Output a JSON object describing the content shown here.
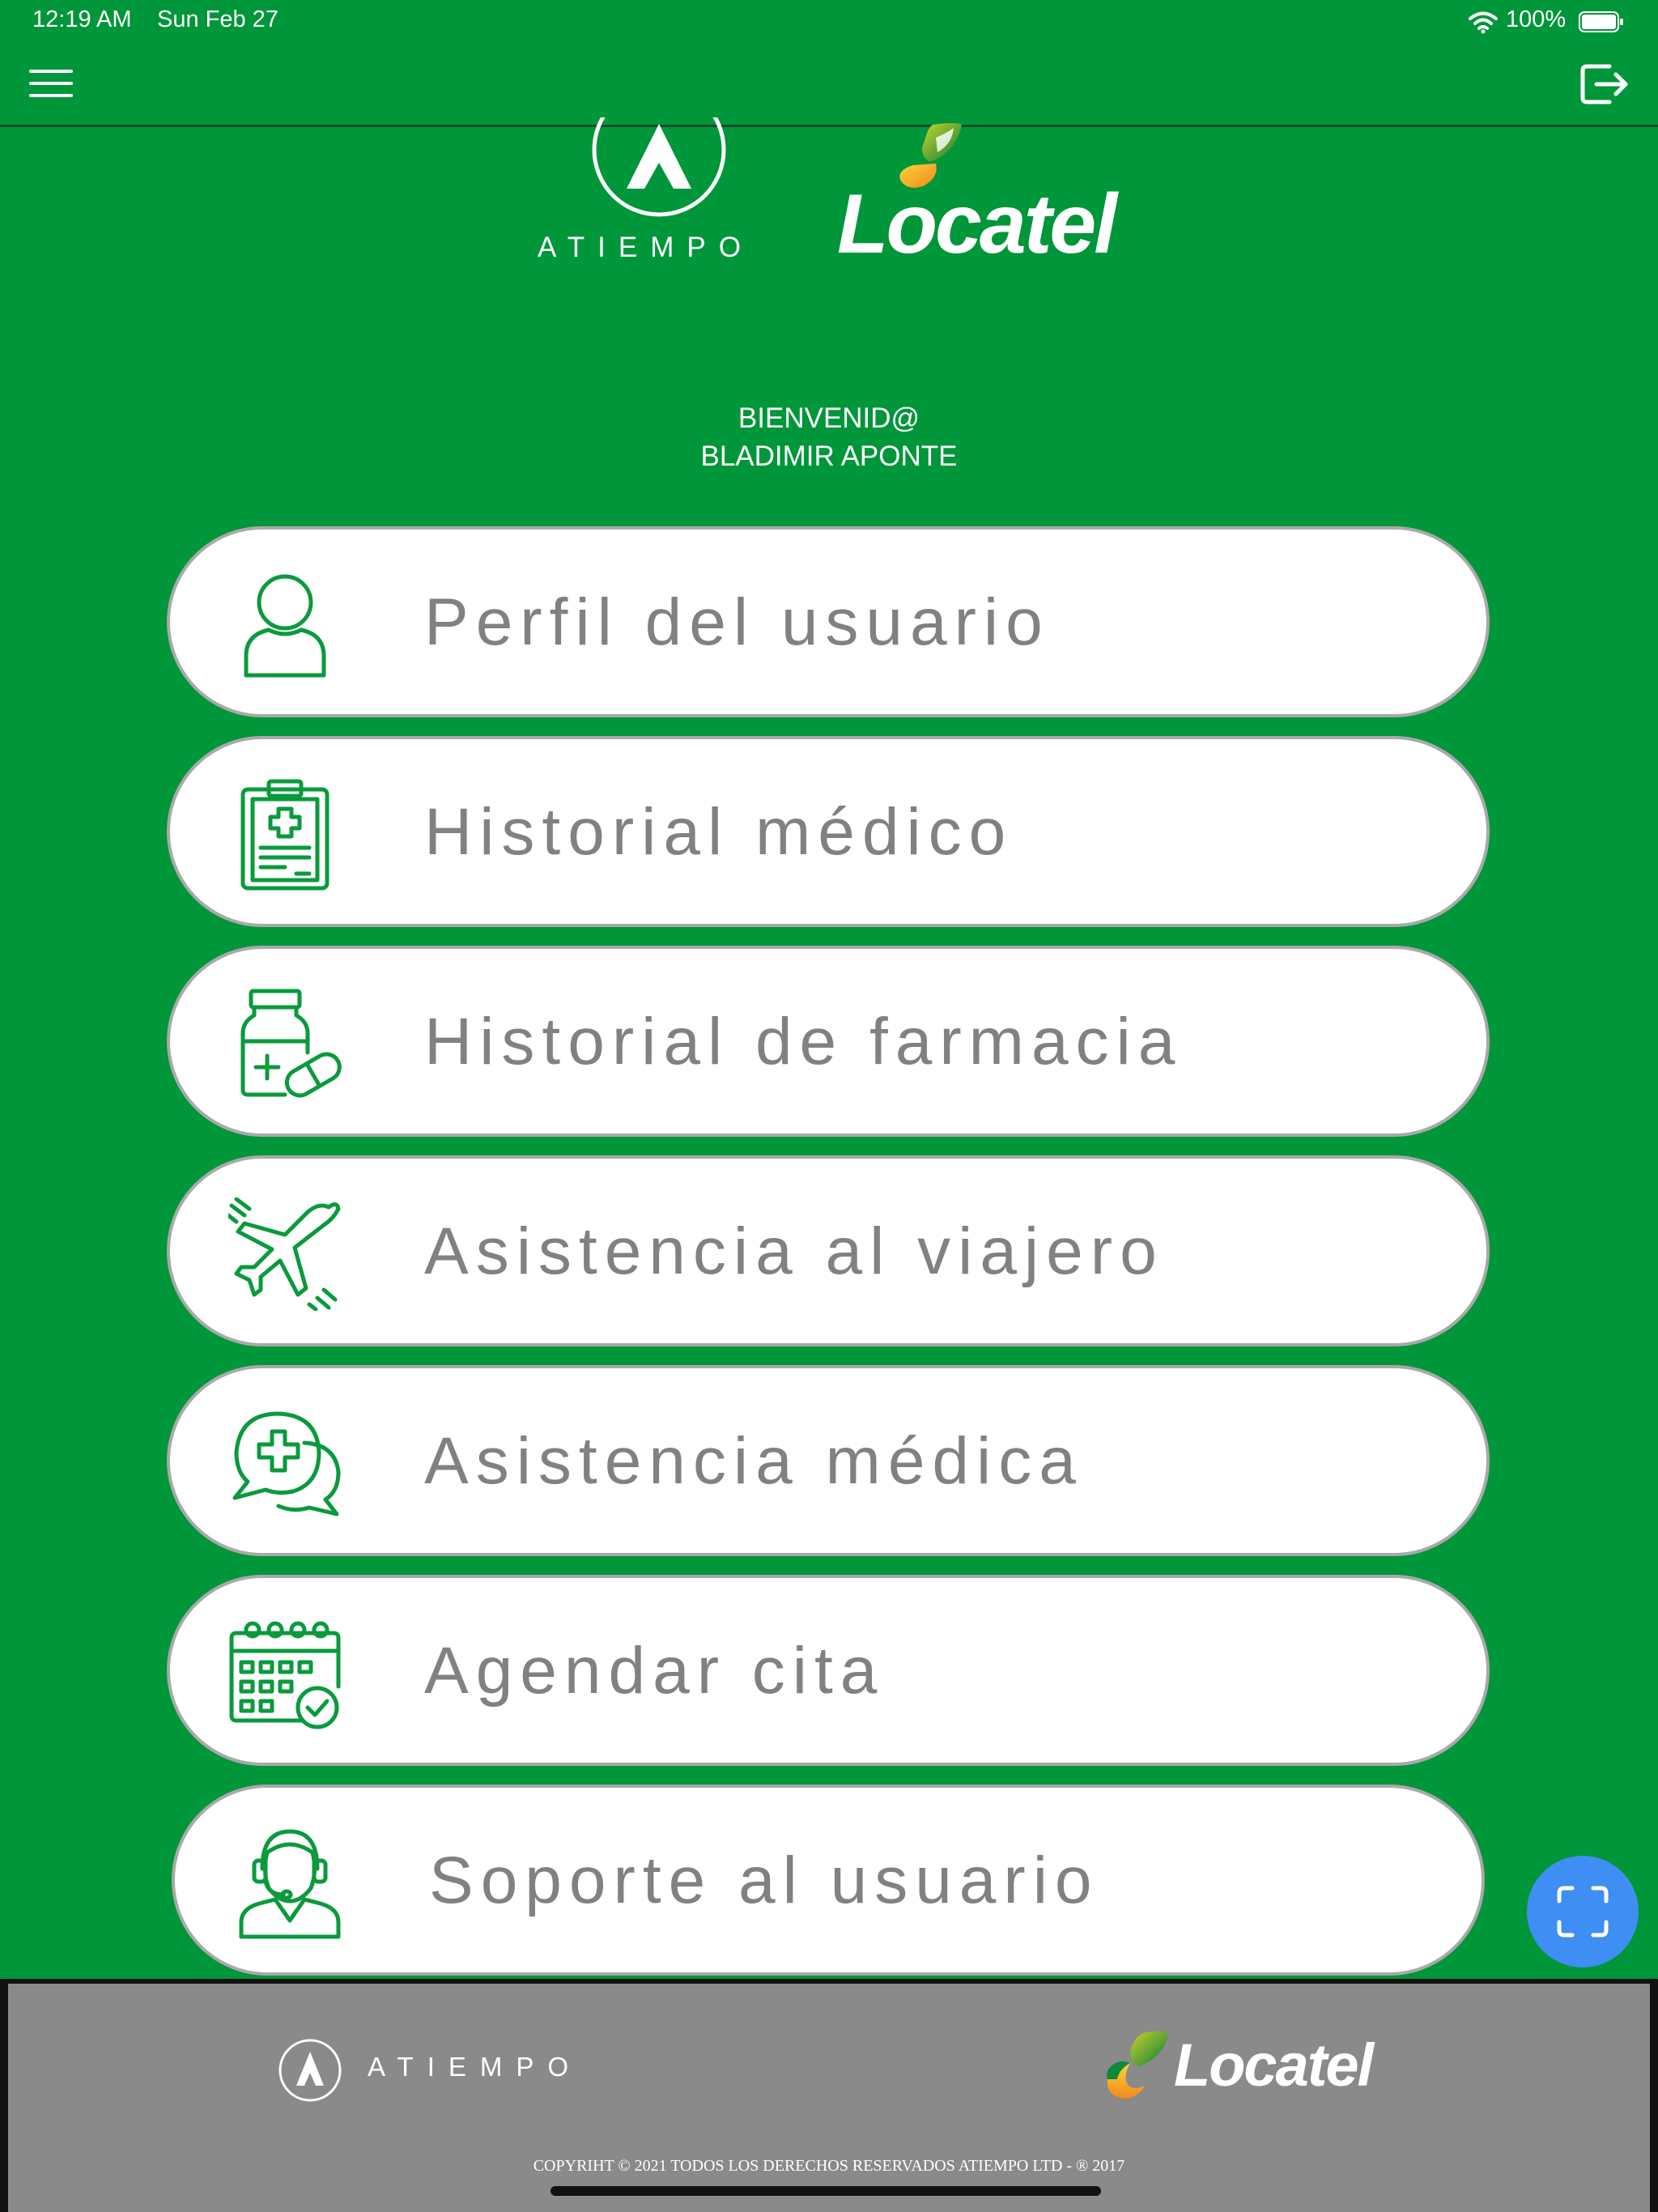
{
  "status_bar": {
    "time": "12:19 AM",
    "date": "Sun Feb 27",
    "battery": "100%",
    "icons": [
      "wifi-icon",
      "battery-icon"
    ]
  },
  "nav": {
    "menu_icon": "hamburger-menu-icon",
    "logout_icon": "logout-icon"
  },
  "header": {
    "atiempo_text": "ATIEMPO",
    "locatel_text": "Locatel"
  },
  "welcome": {
    "greeting": "BIENVENID@",
    "user_name": "BLADIMIR APONTE"
  },
  "menu": [
    {
      "label": "Perfil del usuario",
      "icon": "user-icon"
    },
    {
      "label": "Historial médico",
      "icon": "clipboard-icon"
    },
    {
      "label": "Historial de farmacia",
      "icon": "medicine-bottle-icon"
    },
    {
      "label": "Asistencia al viajero",
      "icon": "airplane-icon"
    },
    {
      "label": "Asistencia médica",
      "icon": "medical-chat-icon"
    },
    {
      "label": "Agendar cita",
      "icon": "calendar-icon"
    },
    {
      "label": "Soporte al usuario",
      "icon": "support-agent-icon"
    }
  ],
  "fab": {
    "icon": "scan-icon"
  },
  "footer": {
    "atiempo_text": "ATIEMPO",
    "locatel_text": "Locatel",
    "copyright": "COPYRIHT © 2021 TODOS LOS DERECHOS RESERVADOS ATIEMPO LTD - ® 2017"
  },
  "colors": {
    "background": "#00963a",
    "icon_green": "#0a9a3c",
    "label_gray": "#818181",
    "footer": "#8a8a8a",
    "fab": "#3f8ef3"
  }
}
